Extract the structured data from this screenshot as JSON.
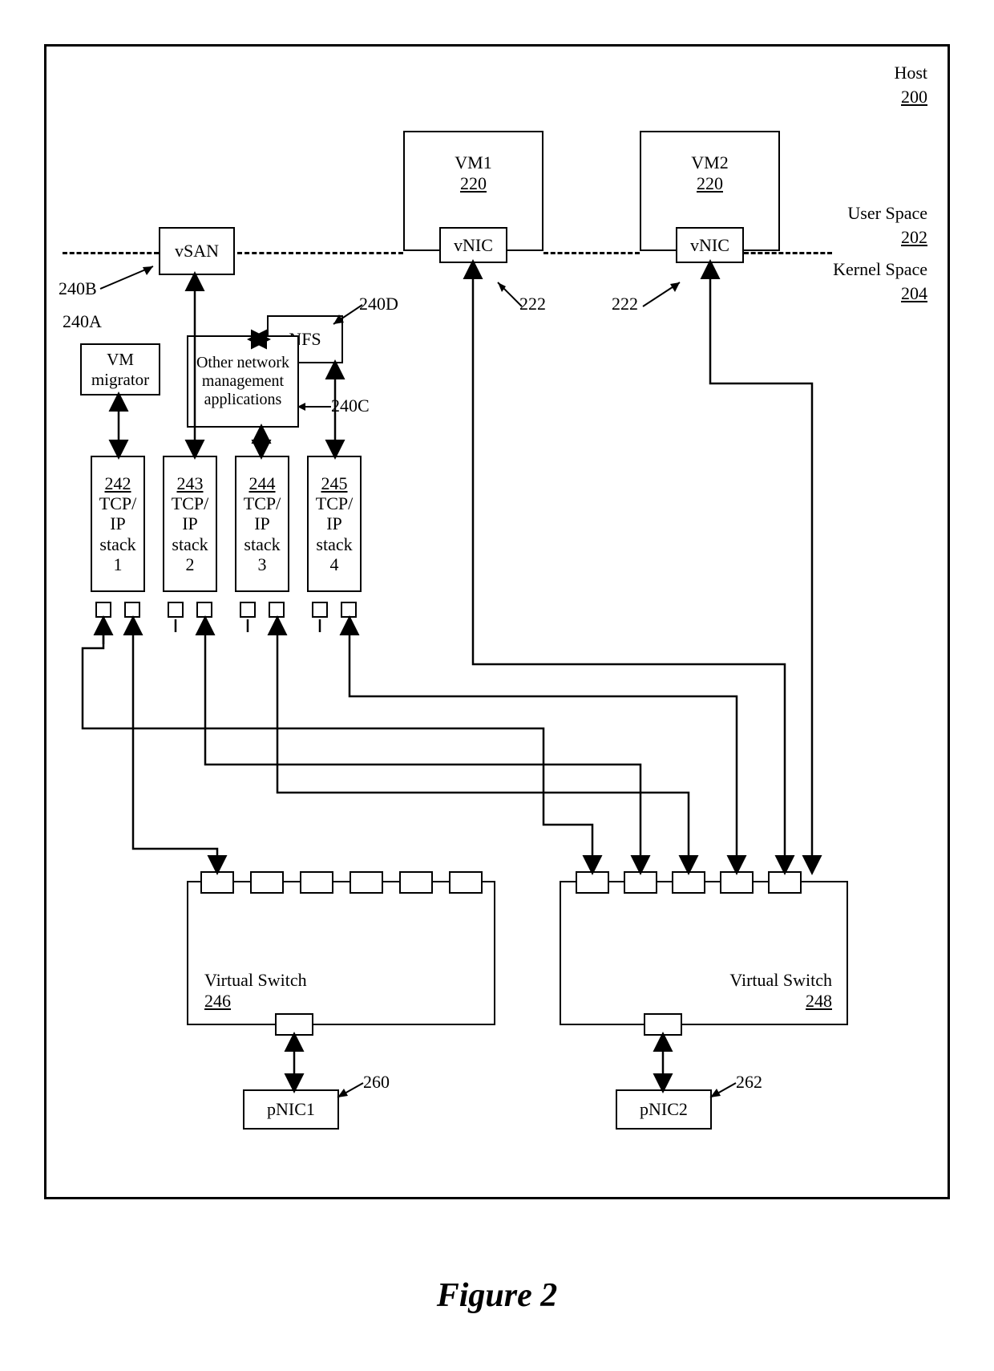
{
  "host": {
    "name": "Host",
    "ref": "200"
  },
  "spaces": {
    "user": {
      "name": "User Space",
      "ref": "202"
    },
    "kernel": {
      "name": "Kernel Space",
      "ref": "204"
    }
  },
  "vms": {
    "vm1": {
      "name": "VM1",
      "ref": "220",
      "nic": "vNIC",
      "nic_ref": "222"
    },
    "vm2": {
      "name": "VM2",
      "ref": "220",
      "nic": "vNIC",
      "nic_ref": "222"
    }
  },
  "kernel_apps": {
    "vm_migrator": {
      "name": "VM migrator",
      "ref": "240A"
    },
    "vsan": {
      "name": "vSAN",
      "ref": "240B"
    },
    "other_mgmt": {
      "name": "Other network management applications",
      "ref": "240C"
    },
    "nfs": {
      "name": "NFS",
      "ref": "240D"
    }
  },
  "tcp_stacks": {
    "s1": {
      "ref": "242",
      "name": "TCP/\nIP\nstack\n1"
    },
    "s2": {
      "ref": "243",
      "name": "TCP/\nIP\nstack\n2"
    },
    "s3": {
      "ref": "244",
      "name": "TCP/\nIP\nstack\n3"
    },
    "s4": {
      "ref": "245",
      "name": "TCP/\nIP\nstack\n4"
    }
  },
  "vswitches": {
    "vs1": {
      "name": "Virtual Switch",
      "ref": "246"
    },
    "vs2": {
      "name": "Virtual Switch",
      "ref": "248"
    }
  },
  "pnics": {
    "p1": {
      "name": "pNIC1",
      "ref": "260"
    },
    "p2": {
      "name": "pNIC2",
      "ref": "262"
    }
  },
  "figure": "Figure 2"
}
